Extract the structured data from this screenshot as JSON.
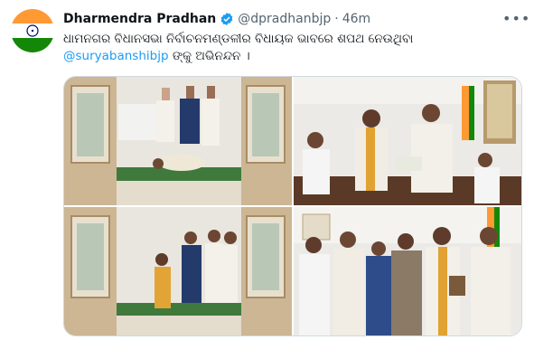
{
  "author": {
    "name": "Dharmendra Pradhan",
    "handle": "@dpradhanbjp",
    "separator": "·",
    "time": "46m",
    "avatar_icon": "india-flag-icon",
    "verified_icon": "verified-badge-icon"
  },
  "more_icon": "more-options-icon",
  "tweet": {
    "text_before": "ଧାମନଗର ବିଧାନସଭା ନିର୍ବାଚନମଣ୍ଡଳୀର ବିଧାୟକ ଭାବରେ ଶପଥ ନେଉଥିବା ",
    "mention": "@suryabanshibjp",
    "text_after": " ଙ୍କୁ ଅଭିନନ୍ଦନ ।"
  },
  "colors": {
    "link": "#1d9bf0",
    "secondary": "#536471",
    "border": "#cfd9de"
  },
  "media": [
    {
      "name": "photo-bowing"
    },
    {
      "name": "photo-oath-ceremony"
    },
    {
      "name": "photo-doorway-greeting"
    },
    {
      "name": "photo-group-memento"
    }
  ]
}
